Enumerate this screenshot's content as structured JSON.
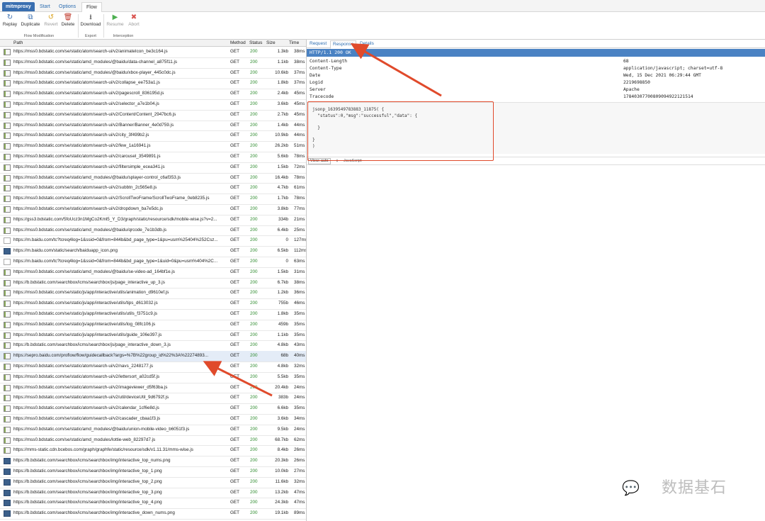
{
  "tabs": [
    {
      "label": "mitmproxy"
    },
    {
      "label": "Start"
    },
    {
      "label": "Options"
    },
    {
      "label": "Flow"
    }
  ],
  "toolbar": {
    "buttons": [
      {
        "label": "Replay",
        "icon": "replay-icon"
      },
      {
        "label": "Duplicate",
        "icon": "duplicate-icon"
      },
      {
        "label": "Revert",
        "icon": "revert-icon"
      },
      {
        "label": "Delete",
        "icon": "delete-icon"
      },
      {
        "label": "Download",
        "icon": "download-icon"
      },
      {
        "label": "Resume",
        "icon": "resume-icon"
      },
      {
        "label": "Abort",
        "icon": "abort-icon"
      }
    ],
    "groups": [
      "Flow Modification",
      "Export",
      "Interception"
    ]
  },
  "columns": {
    "path": "Path",
    "method": "Method",
    "status": "Status",
    "size": "Size",
    "time": "Time"
  },
  "rows": [
    {
      "path": "https://mss0.bdstatic.com/se/static/atom/search-ui/v2/animateIcon_be3c164.js",
      "method": "GET",
      "status": "200",
      "size": "1.3kb",
      "time": "38ms",
      "icon": "js"
    },
    {
      "path": "https://mss0.bdstatic.com/se/static/amd_modules/@baidu/data-channel_a875f11.js",
      "method": "GET",
      "status": "200",
      "size": "1.1kb",
      "time": "38ms",
      "icon": "js"
    },
    {
      "path": "https://mss0.bdstatic.com/se/static/amd_modules/@baidu/xbox-player_445c0dc.js",
      "method": "GET",
      "status": "200",
      "size": "10.6kb",
      "time": "37ms",
      "icon": "js"
    },
    {
      "path": "https://mss0.bdstatic.com/se/static/atom/search-ui/v2/collapse_ee753a1.js",
      "method": "GET",
      "status": "200",
      "size": "1.8kb",
      "time": "37ms",
      "icon": "js"
    },
    {
      "path": "https://mss0.bdstatic.com/se/static/atom/search-ui/v2/pagescroll_836195d.js",
      "method": "GET",
      "status": "200",
      "size": "2.4kb",
      "time": "45ms",
      "icon": "js"
    },
    {
      "path": "https://mss0.bdstatic.com/se/static/atom/search-ui/v2/selector_a7e1b04.js",
      "method": "GET",
      "status": "200",
      "size": "3.6kb",
      "time": "45ms",
      "icon": "js"
    },
    {
      "path": "https://mss0.bdstatic.com/se/static/atom/search-ui/v2/Content/Content_2947bc6.js",
      "method": "GET",
      "status": "200",
      "size": "2.7kb",
      "time": "45ms",
      "icon": "js"
    },
    {
      "path": "https://mss0.bdstatic.com/se/static/atom/search-ui/v2/Banner/Banner_4e0d759.js",
      "method": "GET",
      "status": "200",
      "size": "1.4kb",
      "time": "44ms",
      "icon": "js"
    },
    {
      "path": "https://mss0.bdstatic.com/se/static/atom/search-ui/v2/city_3f499b2.js",
      "method": "GET",
      "status": "200",
      "size": "10.9kb",
      "time": "44ms",
      "icon": "js"
    },
    {
      "path": "https://mss0.bdstatic.com/se/static/atom/search-ui/v2/few_1a16941.js",
      "method": "GET",
      "status": "200",
      "size": "26.2kb",
      "time": "51ms",
      "icon": "js"
    },
    {
      "path": "https://mss0.bdstatic.com/se/static/atom/search-ui/v2/carousel_3549891.js",
      "method": "GET",
      "status": "200",
      "size": "5.6kb",
      "time": "78ms",
      "icon": "js"
    },
    {
      "path": "https://mss0.bdstatic.com/se/static/atom/search-ui/v2/filtersimple_ecea341.js",
      "method": "GET",
      "status": "200",
      "size": "1.5kb",
      "time": "72ms",
      "icon": "js"
    },
    {
      "path": "https://mss0.bdstatic.com/se/static/amd_modules/@baidu/splayer-control_c6af353.js",
      "method": "GET",
      "status": "200",
      "size": "16.4kb",
      "time": "78ms",
      "icon": "js"
    },
    {
      "path": "https://mss0.bdstatic.com/se/static/atom/search-ui/v2/subbtn_2c565e8.js",
      "method": "GET",
      "status": "200",
      "size": "4.7kb",
      "time": "61ms",
      "icon": "js"
    },
    {
      "path": "https://mss0.bdstatic.com/se/static/atom/search-ui/v2/ScrollTwoFrame/ScrollTwoFrame_0eb8235.js",
      "method": "GET",
      "status": "200",
      "size": "1.7kb",
      "time": "78ms",
      "icon": "js"
    },
    {
      "path": "https://mss0.bdstatic.com/se/static/atom/search-ui/v2/dropdown_ba7e5dc.js",
      "method": "GET",
      "status": "200",
      "size": "3.8kb",
      "time": "77ms",
      "icon": "js"
    },
    {
      "path": "https://gss3.bdstatic.com/5foUcz3n1MgCo2Kml5_Y_D3/graph/static/resource/sdk/mobile-wise.js?v=2...",
      "method": "GET",
      "status": "200",
      "size": "334b",
      "time": "21ms",
      "icon": "js"
    },
    {
      "path": "https://mss0.bdstatic.com/se/static/amd_modules/@baidu/qrcode_7e1b3db.js",
      "method": "GET",
      "status": "200",
      "size": "6.4kb",
      "time": "25ms",
      "icon": "js"
    },
    {
      "path": "https://m.baidu.com/tc?tcreq4log=1&ssid=0&from=844b&bd_page_type=1&pu=usm%25404%252Csz...",
      "method": "GET",
      "status": "200",
      "size": "0",
      "time": "127ms",
      "icon": "blank"
    },
    {
      "path": "https://m.baidu.com/static/search/baiduapp_icon.png",
      "method": "GET",
      "status": "200",
      "size": "6.5kb",
      "time": "112ms",
      "icon": "img"
    },
    {
      "path": "https://m.baidu.com/tc?tcreq4log=1&ssid=0&from=844b&bd_page_type=1&uid=0&pu=usm%404%2C...",
      "method": "GET",
      "status": "200",
      "size": "0",
      "time": "63ms",
      "icon": "blank"
    },
    {
      "path": "https://mss0.bdstatic.com/se/static/amd_modules/@baidu/se-video-ad_164bf1e.js",
      "method": "GET",
      "status": "200",
      "size": "1.5kb",
      "time": "31ms",
      "icon": "js"
    },
    {
      "path": "https://b.bdstatic.com/searchbox/icms/searchbox/js/page_interactive_up_3.js",
      "method": "GET",
      "status": "200",
      "size": "6.7kb",
      "time": "38ms",
      "icon": "js"
    },
    {
      "path": "https://mss0.bdstatic.com/se/static/js/app/interactive/utils/animation_d9610ef.js",
      "method": "GET",
      "status": "200",
      "size": "1.2kb",
      "time": "36ms",
      "icon": "js"
    },
    {
      "path": "https://mss0.bdstatic.com/se/static/js/app/interactive/utils/tips_d613032.js",
      "method": "GET",
      "status": "200",
      "size": "755b",
      "time": "46ms",
      "icon": "js"
    },
    {
      "path": "https://mss0.bdstatic.com/se/static/js/app/interactive/utils/utils_f3751c9.js",
      "method": "GET",
      "status": "200",
      "size": "1.8kb",
      "time": "35ms",
      "icon": "js"
    },
    {
      "path": "https://mss0.bdstatic.com/se/static/js/app/interactive/utils/log_08fc106.js",
      "method": "GET",
      "status": "200",
      "size": "459b",
      "time": "35ms",
      "icon": "js"
    },
    {
      "path": "https://mss0.bdstatic.com/se/static/js/app/interactive/utils/guide_106e397.js",
      "method": "GET",
      "status": "200",
      "size": "1.1kb",
      "time": "35ms",
      "icon": "js"
    },
    {
      "path": "https://b.bdstatic.com/searchbox/icms/searchbox/js/page_interactive_down_3.js",
      "method": "GET",
      "status": "200",
      "size": "4.8kb",
      "time": "43ms",
      "icon": "js"
    },
    {
      "path": "https://sepro.baidu.com/proflow/flow/guidecallback?args=%7B%22group_id%22%3A%22274893...",
      "method": "GET",
      "status": "200",
      "size": "68b",
      "time": "40ms",
      "icon": "js",
      "selected": true
    },
    {
      "path": "https://mss0.bdstatic.com/se/static/atom/search-ui/v2/navs_2248177.js",
      "method": "GET",
      "status": "200",
      "size": "4.8kb",
      "time": "32ms",
      "icon": "js"
    },
    {
      "path": "https://mss0.bdstatic.com/se/static/atom/search-ui/v2/lettersort_a02cd5f.js",
      "method": "GET",
      "status": "200",
      "size": "5.5kb",
      "time": "35ms",
      "icon": "js"
    },
    {
      "path": "https://mss0.bdstatic.com/se/static/atom/search-ui/v2/imageviewer_d5f63ba.js",
      "method": "GET",
      "status": "200",
      "size": "20.4kb",
      "time": "24ms",
      "icon": "js"
    },
    {
      "path": "https://mss0.bdstatic.com/se/static/atom/search-ui/v2/util/deviceUtil_9d6792f.js",
      "method": "GET",
      "status": "200",
      "size": "383b",
      "time": "24ms",
      "icon": "js"
    },
    {
      "path": "https://mss0.bdstatic.com/se/static/atom/search-ui/v2/calendar_1cf6e8d.js",
      "method": "GET",
      "status": "200",
      "size": "6.6kb",
      "time": "35ms",
      "icon": "js"
    },
    {
      "path": "https://mss0.bdstatic.com/se/static/atom/search-ui/v2/cascader_cbaa1f3.js",
      "method": "GET",
      "status": "200",
      "size": "3.6kb",
      "time": "34ms",
      "icon": "js"
    },
    {
      "path": "https://mss0.bdstatic.com/se/static/amd_modules/@baidu/union-mobile-video_b6051f3.js",
      "method": "GET",
      "status": "200",
      "size": "9.5kb",
      "time": "24ms",
      "icon": "js"
    },
    {
      "path": "https://mss0.bdstatic.com/se/static/amd_modules/lottie-web_82297d7.js",
      "method": "GET",
      "status": "200",
      "size": "68.7kb",
      "time": "62ms",
      "icon": "js"
    },
    {
      "path": "https://mms-static.cdn.bcebos.com/graph/graphfe/static/resource/sdk/v1.11.31/mms-wise.js",
      "method": "GET",
      "status": "200",
      "size": "8.4kb",
      "time": "26ms",
      "icon": "js"
    },
    {
      "path": "https://b.bdstatic.com/searchbox/icms/searchbox/img/interactive_top_nums.png",
      "method": "GET",
      "status": "200",
      "size": "20.3kb",
      "time": "26ms",
      "icon": "img"
    },
    {
      "path": "https://b.bdstatic.com/searchbox/icms/searchbox/img/interactive_top_1.png",
      "method": "GET",
      "status": "200",
      "size": "10.0kb",
      "time": "27ms",
      "icon": "img"
    },
    {
      "path": "https://b.bdstatic.com/searchbox/icms/searchbox/img/interactive_top_2.png",
      "method": "GET",
      "status": "200",
      "size": "11.6kb",
      "time": "32ms",
      "icon": "img"
    },
    {
      "path": "https://b.bdstatic.com/searchbox/icms/searchbox/img/interactive_top_3.png",
      "method": "GET",
      "status": "200",
      "size": "13.2kb",
      "time": "47ms",
      "icon": "img"
    },
    {
      "path": "https://b.bdstatic.com/searchbox/icms/searchbox/img/interactive_top_4.png",
      "method": "GET",
      "status": "200",
      "size": "24.3kb",
      "time": "47ms",
      "icon": "img"
    },
    {
      "path": "https://b.bdstatic.com/searchbox/icms/searchbox/img/interactive_down_nums.png",
      "method": "GET",
      "status": "200",
      "size": "19.1kb",
      "time": "89ms",
      "icon": "img"
    }
  ],
  "detail": {
    "tabs": [
      "Request",
      "Response",
      "Details"
    ],
    "status_line": "HTTP/1.1 200 OK",
    "headers": [
      {
        "name": "Content-Length",
        "value": "68"
      },
      {
        "name": "Content-Type",
        "value": "application/javascript; charset=utf-8"
      },
      {
        "name": "Date",
        "value": "Wed, 15 Dec 2021 06:29:44 GMT"
      },
      {
        "name": "Logid",
        "value": "2219698850"
      },
      {
        "name": "Server",
        "value": "Apache"
      },
      {
        "name": "Tracecode",
        "value": "17840307700809094922121514"
      }
    ],
    "body_lines": [
      "jsonp_1639549783883_11875( {",
      "  \"status\":0,\"msg\":\"successful\",\"data\": {",
      "",
      "  }",
      "",
      "}",
      ")"
    ],
    "view_button": "View: auto",
    "view_mode": "JavaScript"
  },
  "watermark": "数据基石",
  "colors": {
    "accent": "#4a82c3",
    "annotation": "#e04a2b",
    "status_ok": "#2e8b2e"
  }
}
